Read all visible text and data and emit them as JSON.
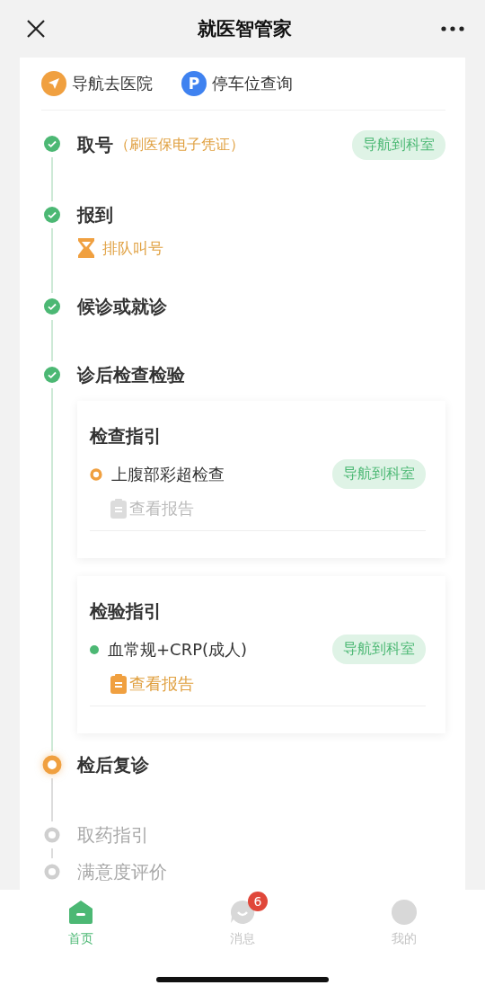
{
  "header": {
    "title": "就医智管家"
  },
  "quick_links": [
    {
      "kind": "navigate",
      "label": "导航去医院"
    },
    {
      "kind": "parking",
      "icon_letter": "P",
      "label": "停车位查询"
    }
  ],
  "steps": [
    {
      "completed": true,
      "current": false,
      "title": "取号",
      "note": "（刷医保电子凭证）",
      "action": "导航到科室"
    },
    {
      "completed": true,
      "current": false,
      "title": "报到",
      "link": "排队叫号"
    },
    {
      "completed": true,
      "current": false,
      "title": "候诊或就诊"
    },
    {
      "completed": true,
      "current": false,
      "title": "诊后检查检验",
      "guides": [
        {
          "title": "检查指引",
          "items": [
            {
              "completed": false,
              "name": "上腹部彩超检查",
              "action": "导航到科室",
              "report": "查看报告",
              "report_available": false
            }
          ]
        },
        {
          "title": "检验指引",
          "items": [
            {
              "completed": true,
              "name": "血常规+CRP(成人)",
              "action": "导航到科室",
              "report": "查看报告",
              "report_available": true
            }
          ]
        }
      ]
    },
    {
      "completed": false,
      "current": true,
      "title": "检后复诊"
    },
    {
      "completed": false,
      "current": false,
      "title": "取药指引"
    },
    {
      "completed": false,
      "current": false,
      "title": "满意度评价"
    }
  ],
  "tabs": [
    {
      "kind": "home",
      "label": "首页",
      "selected": true
    },
    {
      "kind": "messages",
      "label": "消息",
      "selected": false,
      "badge": "6"
    },
    {
      "kind": "profile",
      "label": "我的",
      "selected": false
    }
  ]
}
